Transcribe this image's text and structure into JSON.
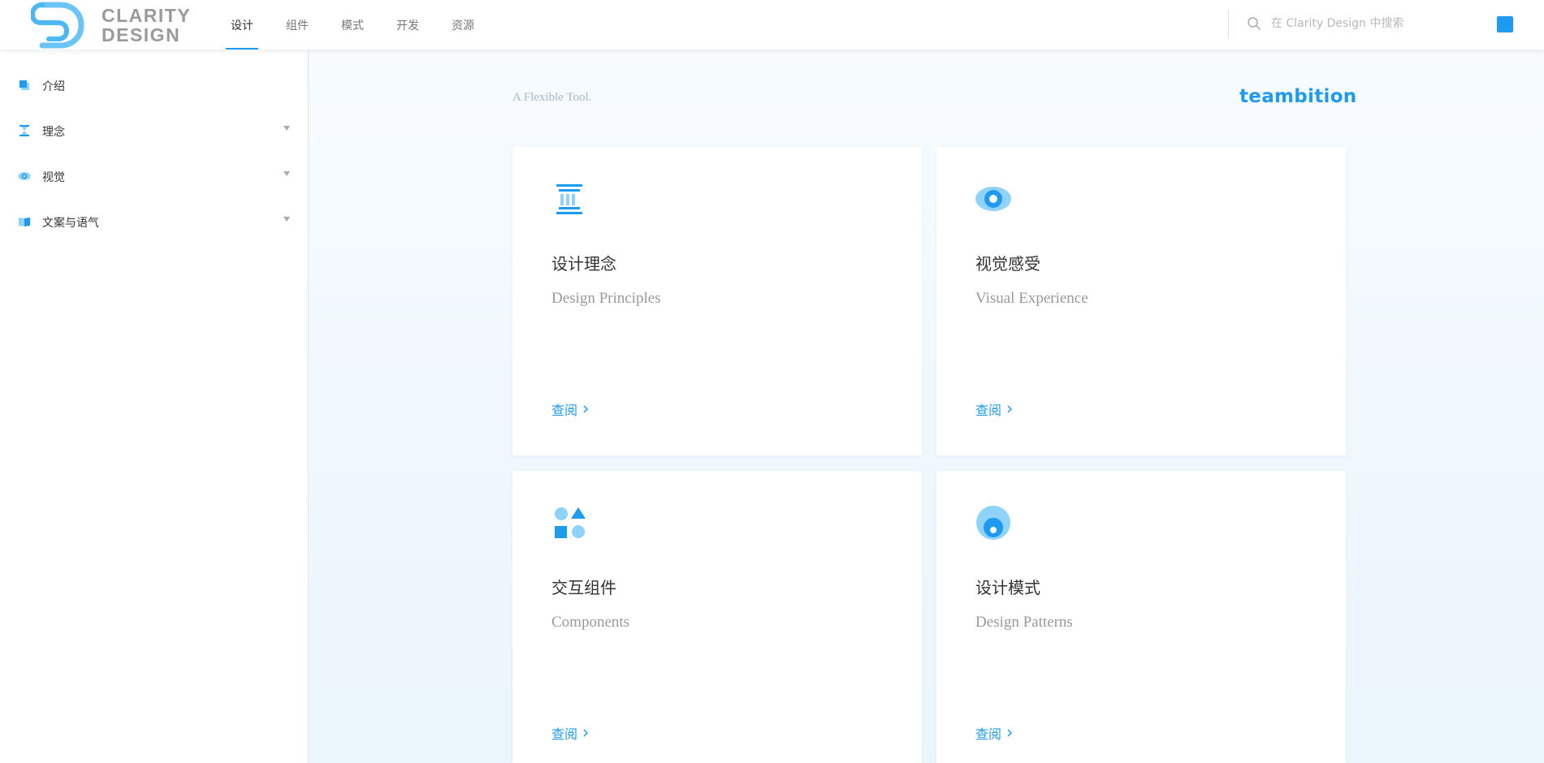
{
  "header": {
    "logo_line1": "CLARITY",
    "logo_line2": "DESIGN",
    "nav": [
      "设计",
      "组件",
      "模式",
      "开发",
      "资源"
    ],
    "active_nav": "设计",
    "search_placeholder": "在 Clarity Design 中搜索"
  },
  "sidebar": {
    "items": [
      {
        "label": "介绍",
        "icon": "intro-icon",
        "expandable": false
      },
      {
        "label": "理念",
        "icon": "hourglass-icon",
        "expandable": true
      },
      {
        "label": "视觉",
        "icon": "eye-icon",
        "expandable": true
      },
      {
        "label": "文案与语气",
        "icon": "book-icon",
        "expandable": true
      }
    ]
  },
  "main": {
    "tagline": "A Flexible Tool.",
    "brand": "teambition",
    "cards": [
      {
        "title": "设计理念",
        "subtitle": "Design Principles",
        "link": "查阅",
        "icon": "pillar-icon"
      },
      {
        "title": "视觉感受",
        "subtitle": "Visual Experience",
        "link": "查阅",
        "icon": "eye-icon"
      },
      {
        "title": "交互组件",
        "subtitle": "Components",
        "link": "查阅",
        "icon": "shapes-icon"
      },
      {
        "title": "设计模式",
        "subtitle": "Design Patterns",
        "link": "查阅",
        "icon": "circle-pattern-icon"
      }
    ]
  },
  "colors": {
    "accent": "#1e9bf0",
    "accent_light": "#8fd3fb"
  }
}
